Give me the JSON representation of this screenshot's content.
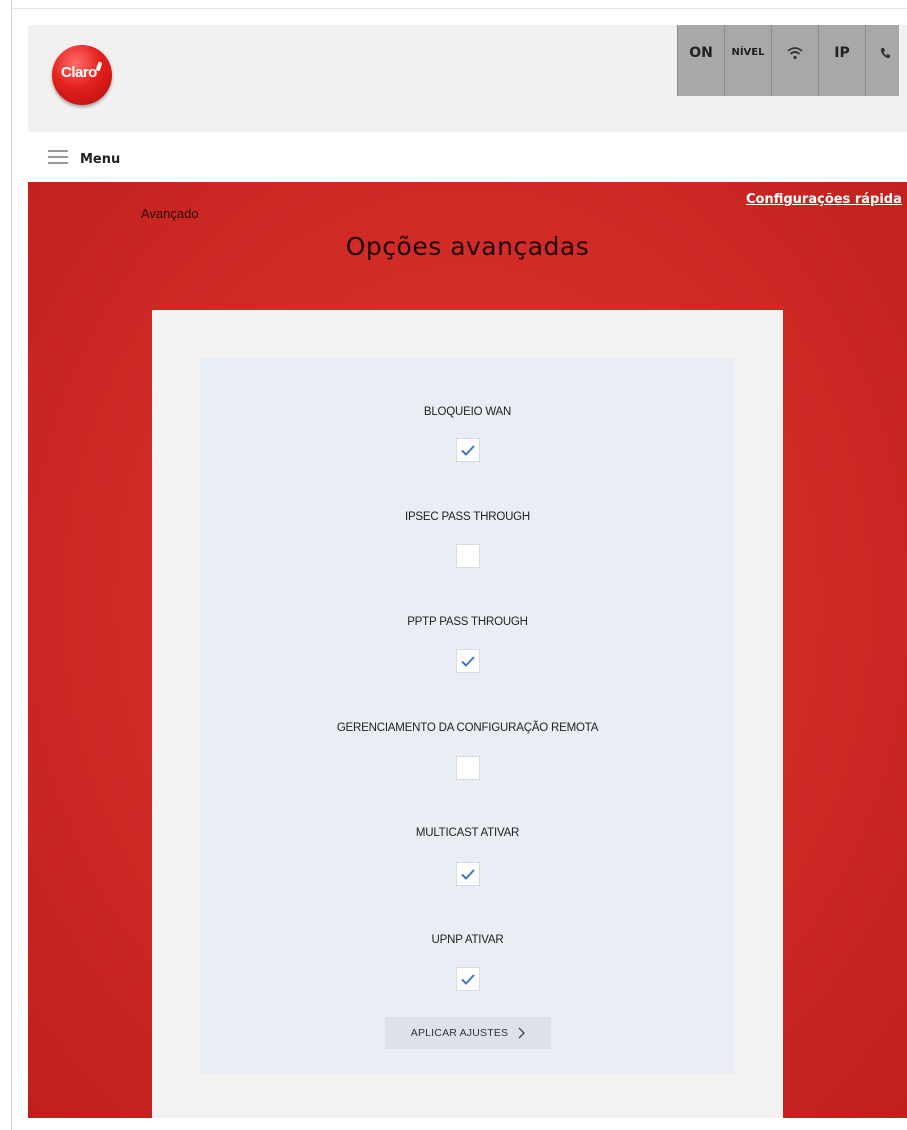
{
  "app": {
    "logo_text": "Claro"
  },
  "status_bar": {
    "items": [
      {
        "label": "ON"
      },
      {
        "label": "NÍVEL"
      },
      {
        "icon": "wifi-icon"
      },
      {
        "label": "IP"
      },
      {
        "icon": "phone-icon"
      }
    ]
  },
  "menu": {
    "label": "Menu",
    "icon": "hamburger-icon"
  },
  "breadcrumb": "Avançado",
  "quick_config_link": "Configurações rápida",
  "page_title": "Opções avançadas",
  "options": [
    {
      "label": "BLOQUEIO WAN",
      "checked": true
    },
    {
      "label": "IPSEC PASS THROUGH",
      "checked": false
    },
    {
      "label": "PPTP PASS THROUGH",
      "checked": true
    },
    {
      "label": "GERENCIAMENTO DA CONFIGURAÇÃO REMOTA",
      "checked": false
    },
    {
      "label": "MULTICAST ATIVAR",
      "checked": true
    },
    {
      "label": "UPNP ATIVAR",
      "checked": true
    }
  ],
  "apply_button": {
    "label": "APLICAR AJUSTES",
    "icon": "chevron-right-icon"
  },
  "colors": {
    "brand_red": "#cf2a26",
    "check_blue": "#3a76c4",
    "panel_bg": "#e9edf4"
  }
}
